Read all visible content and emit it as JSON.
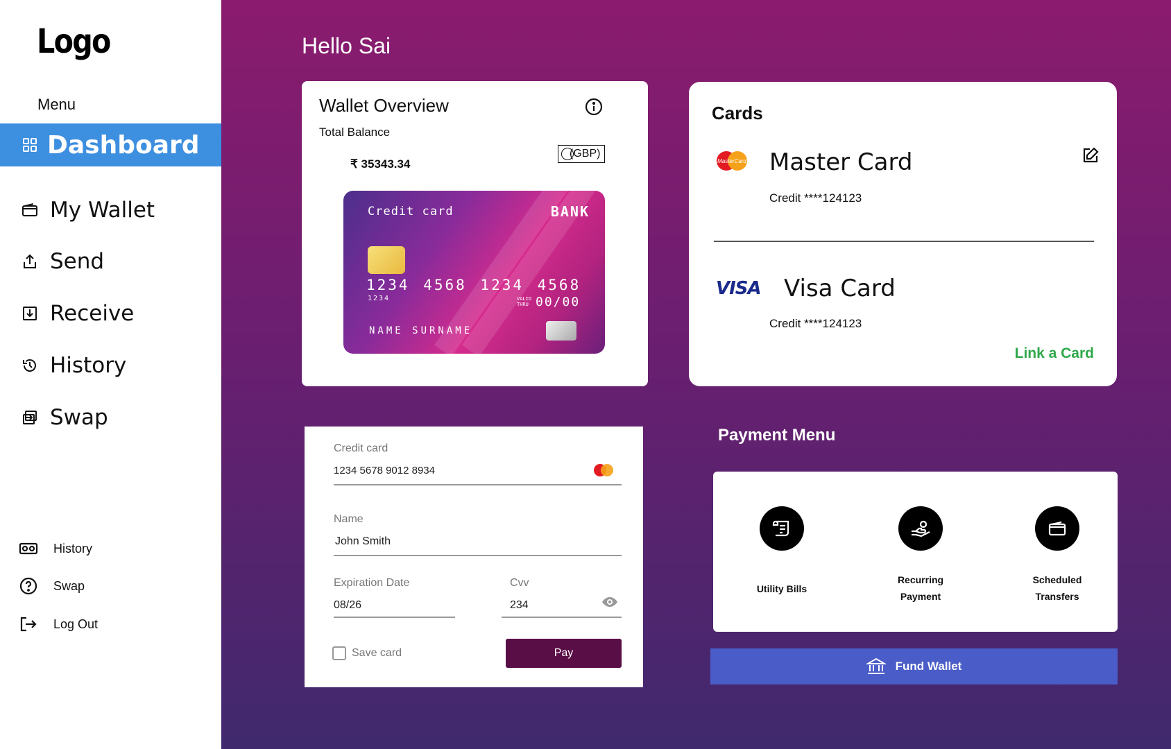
{
  "sidebar": {
    "logo": "Logo",
    "menu_label": "Menu",
    "nav": [
      {
        "label": "Dashboard",
        "icon": "grid-icon",
        "active": true
      },
      {
        "label": "My Wallet",
        "icon": "wallet-icon"
      },
      {
        "label": "Send",
        "icon": "upload-icon"
      },
      {
        "label": "Receive",
        "icon": "download-icon"
      },
      {
        "label": "History",
        "icon": "history-icon"
      },
      {
        "label": "Swap",
        "icon": "swap-icon"
      }
    ],
    "secondary": [
      {
        "label": "History",
        "icon": "vr-headset-icon"
      },
      {
        "label": "Swap",
        "icon": "help-circle-icon"
      },
      {
        "label": "Log Out",
        "icon": "logout-icon"
      }
    ],
    "active_color": "#3d8fe0"
  },
  "header": {
    "greeting": "Hello Sai"
  },
  "wallet_overview": {
    "title": "Wallet Overview",
    "total_label": "Total Balance",
    "balance": "₹ 35343.34",
    "currency": "(GBP)",
    "card_visual": {
      "title": "Credit card",
      "bank": "BANK",
      "number": "1234 4568 1234 4568",
      "sub_number": "1234",
      "valid_label": "VALID THRU",
      "expiry": "00/00",
      "holder": "NAME SURNAME"
    }
  },
  "cards_panel": {
    "title": "Cards",
    "cards": [
      {
        "brand_logo": "MasterCard",
        "name": "Master Card",
        "detail": "Credit ****124123"
      },
      {
        "brand_logo": "VISA",
        "name": "Visa Card",
        "detail": "Credit ****124123"
      }
    ],
    "link_label": "Link a Card",
    "link_color": "#2fa84a"
  },
  "card_form": {
    "card_label": "Credit card",
    "card_value": "1234 5678 9012 8934",
    "name_label": "Name",
    "name_value": "John Smith",
    "expiry_label": "Expiration Date",
    "expiry_value": "08/26",
    "cvv_label": "Cvv",
    "cvv_value": "234",
    "save_label": "Save card",
    "save_checked": false,
    "pay_label": "Pay",
    "pay_color": "#5a0e46"
  },
  "payment_menu": {
    "title": "Payment Menu",
    "items": [
      {
        "label_1": "Utility Bills",
        "label_2": "",
        "icon": "receipt-icon"
      },
      {
        "label_1": "Recurring",
        "label_2": "Payment",
        "icon": "hand-coin-icon"
      },
      {
        "label_1": "Scheduled",
        "label_2": "Transfers",
        "icon": "wallet-icon"
      }
    ],
    "fund_label": "Fund Wallet",
    "fund_icon": "bank-icon",
    "fund_color": "#4a5cc7"
  }
}
